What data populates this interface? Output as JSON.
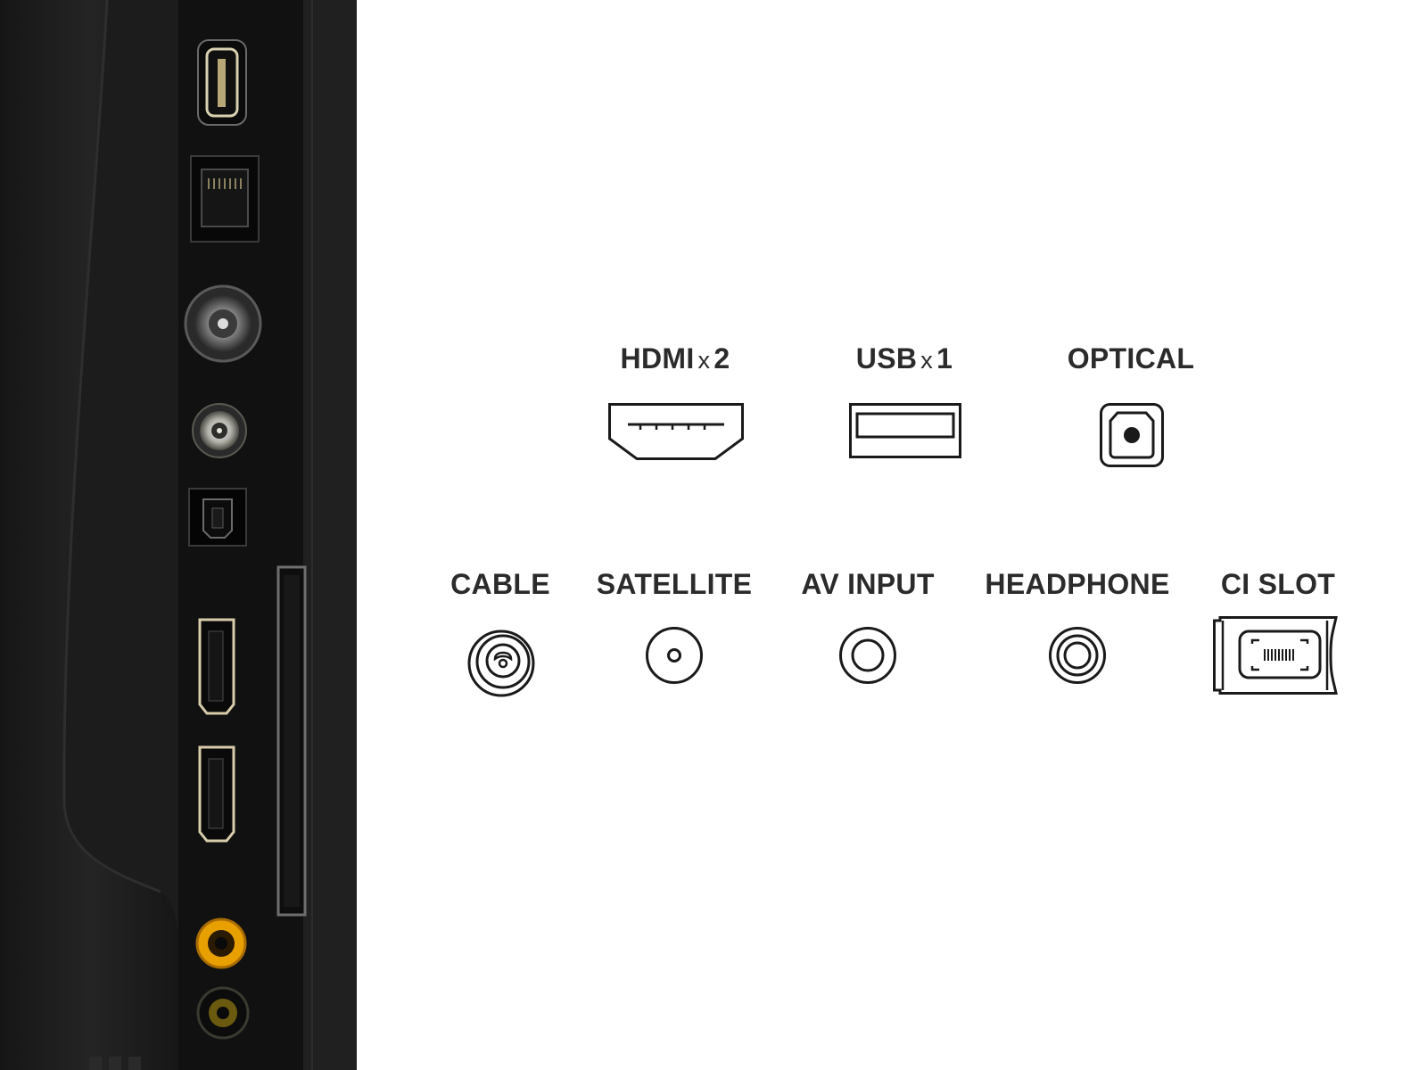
{
  "background_color": "#ffffff",
  "label_color": "#2b2b2b",
  "icon_stroke_color": "#1a1a1a",
  "photo": {
    "subject": "tv-rear-connector-panel",
    "panel_color": "#1a1a1a",
    "accent_color": "#e8a000",
    "ports": [
      "usb-port",
      "ethernet-port",
      "antenna-port",
      "satellite-port",
      "optical-port",
      "ci-slot",
      "hdmi-port",
      "hdmi-port",
      "av-port",
      "headphone-port"
    ]
  },
  "ports": {
    "hdmi": {
      "name": "HDMI",
      "multiplier": "x",
      "count": "2",
      "icon": "hdmi-icon"
    },
    "usb": {
      "name": "USB",
      "multiplier": "x",
      "count": "1",
      "icon": "usb-icon"
    },
    "optical": {
      "name": "OPTICAL",
      "icon": "optical-icon"
    },
    "cable": {
      "name": "CABLE",
      "icon": "cable-icon"
    },
    "satellite": {
      "name": "SATELLITE",
      "icon": "satellite-icon"
    },
    "av_input": {
      "name": "AV INPUT",
      "icon": "av-input-icon"
    },
    "headphone": {
      "name": "HEADPHONE",
      "icon": "headphone-icon"
    },
    "ci_slot": {
      "name": "CI SLOT",
      "icon": "ci-slot-icon"
    }
  }
}
